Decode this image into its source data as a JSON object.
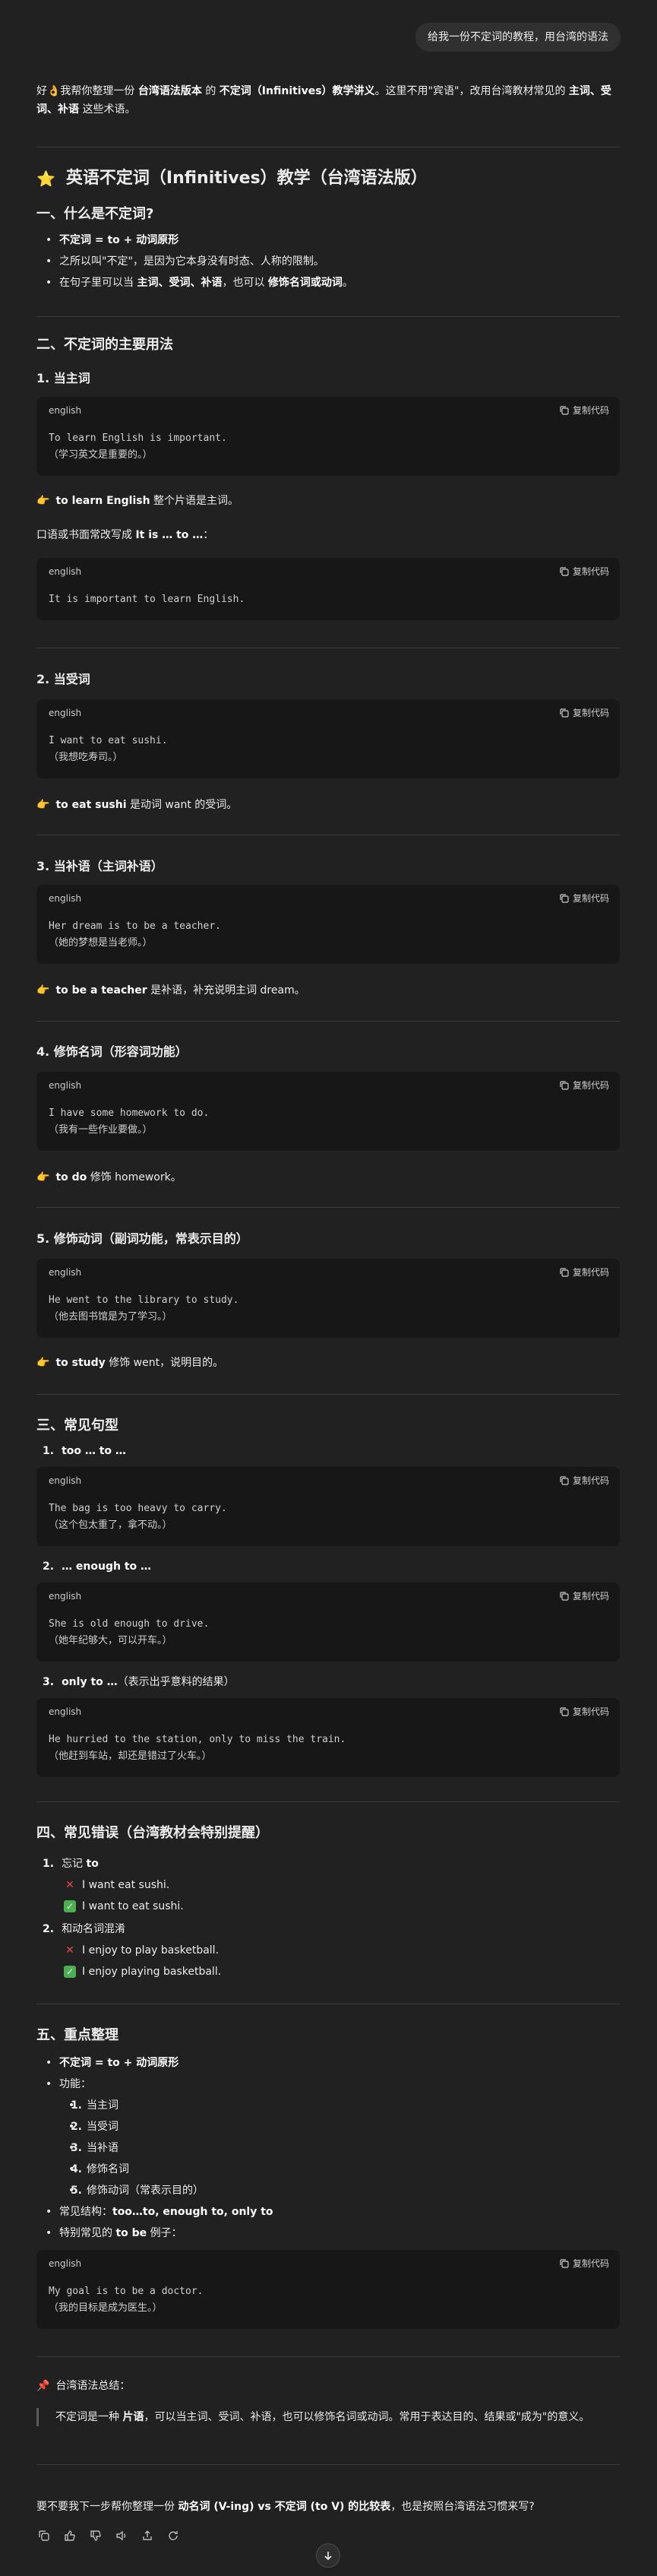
{
  "user_message": "给我一份不定词的教程，用台湾的语法",
  "intro": {
    "p1": "好👌我帮你整理一份 ",
    "b1": "台湾语法版本",
    "p2": " 的 ",
    "b2": "不定词（Infinitives）教学讲义",
    "p3": "。这里不用\"宾语\"，改用台湾教材常见的 ",
    "b3": "主词、受词、补语",
    "p4": " 这些术语。"
  },
  "title": "英语不定词（Infinitives）教学（台湾语法版）",
  "title_icon": "⭐",
  "s1": {
    "heading": "一、什么是不定词?",
    "li1": "不定词 = to + 动词原形",
    "li2": "之所以叫\"不定\"，是因为它本身没有时态、人称的限制。",
    "li3_a": "在句子里可以当 ",
    "li3_b": "主词、受词、补语",
    "li3_c": "，也可以 ",
    "li3_d": "修饰名词或动词",
    "li3_e": "。"
  },
  "s2": {
    "heading": "二、不定词的主要用法",
    "u1": {
      "title": "1. 当主词",
      "code1": {
        "lang": "english",
        "copy": "复制代码",
        "line1": "To learn English is important.",
        "line2": "（学习英文是重要的。）"
      },
      "note_b": "to learn English",
      "note_t": " 整个片语是主词。",
      "extra_a": "口语或书面常改写成 ",
      "extra_b": "It is … to …",
      "extra_c": "：",
      "code2": {
        "lang": "english",
        "copy": "复制代码",
        "line1": "It is important to learn English."
      }
    },
    "u2": {
      "title": "2. 当受词",
      "code": {
        "lang": "english",
        "copy": "复制代码",
        "line1": "I want to eat sushi.",
        "line2": "（我想吃寿司。）"
      },
      "note_b": "to eat sushi",
      "note_t": " 是动词 want 的受词。"
    },
    "u3": {
      "title": "3. 当补语（主词补语）",
      "code": {
        "lang": "english",
        "copy": "复制代码",
        "line1": "Her dream is to be a teacher.",
        "line2": "（她的梦想是当老师。）"
      },
      "note_b": "to be a teacher",
      "note_t": " 是补语，补充说明主词 dream。"
    },
    "u4": {
      "title": "4. 修饰名词（形容词功能）",
      "code": {
        "lang": "english",
        "copy": "复制代码",
        "line1": "I have some homework to do.",
        "line2": "（我有一些作业要做。）"
      },
      "note_b": "to do",
      "note_t": " 修饰 homework。"
    },
    "u5": {
      "title": "5. 修饰动词（副词功能，常表示目的）",
      "code": {
        "lang": "english",
        "copy": "复制代码",
        "line1": "He went to the library to study.",
        "line2": "（他去图书馆是为了学习。）"
      },
      "note_b": "to study",
      "note_t": " 修饰 went，说明目的。"
    }
  },
  "s3": {
    "heading": "三、常见句型",
    "p1": {
      "num": "1.",
      "title": "too … to …",
      "code": {
        "lang": "english",
        "copy": "复制代码",
        "line1": "The bag is too heavy to carry.",
        "line2": "（这个包太重了，拿不动。）"
      }
    },
    "p2": {
      "num": "2.",
      "title": "… enough to …",
      "code": {
        "lang": "english",
        "copy": "复制代码",
        "line1": "She is old enough to drive.",
        "line2": "（她年纪够大，可以开车。）"
      }
    },
    "p3": {
      "num": "3.",
      "title": "only to …",
      "desc": "（表示出乎意料的结果）",
      "code": {
        "lang": "english",
        "copy": "复制代码",
        "line1": "He hurried to the station, only to miss the train.",
        "line2": "（他赶到车站，却还是错过了火车。）"
      }
    }
  },
  "s4": {
    "heading": "四、常见错误（台湾教材会特别提醒）",
    "e1": {
      "num": "1.",
      "label_a": "忘记 ",
      "label_b": "to",
      "wrong": "I want eat sushi.",
      "right": "I want to eat sushi."
    },
    "e2": {
      "num": "2.",
      "label": "和动名词混淆",
      "wrong": "I enjoy to play basketball.",
      "right": "I enjoy playing basketball."
    }
  },
  "s5": {
    "heading": "五、重点整理",
    "li1": "不定词 = to + 动词原形",
    "li2": "功能：",
    "funcs": [
      {
        "num": "1.",
        "text": "当主词"
      },
      {
        "num": "2.",
        "text": "当受词"
      },
      {
        "num": "3.",
        "text": "当补语"
      },
      {
        "num": "4.",
        "text": "修饰名词"
      },
      {
        "num": "5.",
        "text": "修饰动词（常表示目的）"
      }
    ],
    "li3_a": "常见结构：",
    "li3_b": "too…to, enough to, only to",
    "li4_a": "特别常见的 ",
    "li4_b": "to be",
    "li4_c": " 例子：",
    "code": {
      "lang": "english",
      "copy": "复制代码",
      "line1": "My goal is to be a doctor.",
      "line2": "（我的目标是成为医生。）"
    }
  },
  "summary": {
    "icon": "📌",
    "label": "台湾语法总结：",
    "q1": "不定词是一种 ",
    "q2": "片语",
    "q3": "，可以当主词、受词、补语，也可以修饰名词或动词。常用于表达目的、结果或\"成为\"的意义。"
  },
  "followup": {
    "a": "要不要我下一步帮你整理一份 ",
    "b": "动名词 (V-ing) vs 不定词 (to V) 的比较表",
    "c": "，也是按照台湾语法习惯来写?"
  },
  "accent": {
    "bubble": "#303030",
    "code_bg": "#171717",
    "bg": "#212121"
  }
}
